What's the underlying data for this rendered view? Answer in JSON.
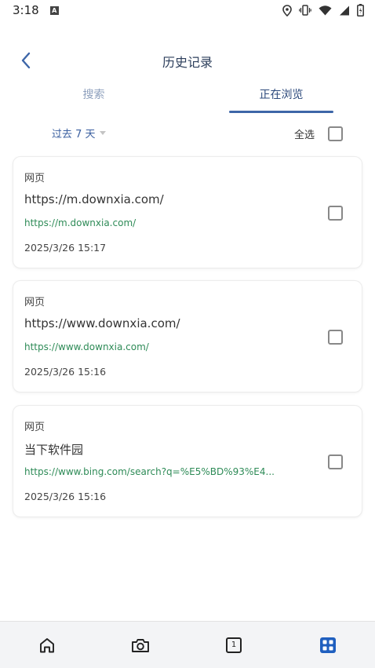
{
  "status_bar": {
    "time": "3:18",
    "icons": [
      "a-notification-icon",
      "location-icon",
      "vibrate-icon",
      "wifi-icon",
      "signal-icon",
      "battery-icon"
    ]
  },
  "header": {
    "title": "历史记录",
    "back_icon": "chevron-left-icon"
  },
  "tabs": [
    {
      "label": "搜索",
      "active": false
    },
    {
      "label": "正在浏览",
      "active": true
    }
  ],
  "filter": {
    "range_label": "过去 7 天",
    "select_all_label": "全选",
    "select_all_checked": false
  },
  "history_items": [
    {
      "type": "网页",
      "title": "https://m.downxia.com/",
      "url": "https://m.downxia.com/",
      "time": "2025/3/26 15:17",
      "checked": false
    },
    {
      "type": "网页",
      "title": "https://www.downxia.com/",
      "url": "https://www.downxia.com/",
      "time": "2025/3/26 15:16",
      "checked": false
    },
    {
      "type": "网页",
      "title": "当下软件园",
      "url": "https://www.bing.com/search?q=%E5%BD%93%E4...",
      "time": "2025/3/26 15:16",
      "checked": false
    }
  ],
  "bottom_nav": {
    "tab_count": "1",
    "items": [
      "home-icon",
      "camera-icon",
      "tabs-icon",
      "apps-icon"
    ],
    "active": "apps-icon"
  },
  "colors": {
    "accent": "#3d66a8",
    "url_green": "#2e8b57",
    "tab_inactive": "#8ea0bd",
    "nav_active": "#1f5fbf"
  }
}
